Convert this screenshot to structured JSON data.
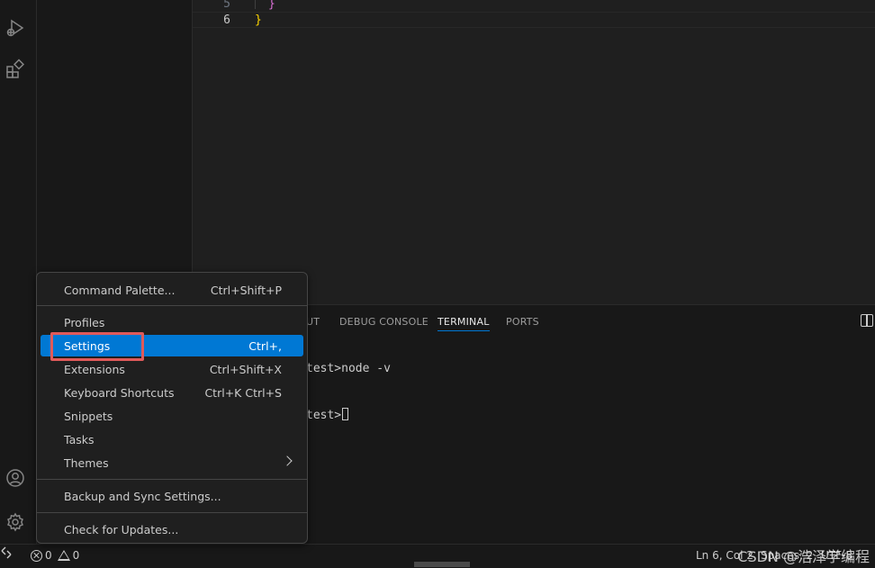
{
  "editor": {
    "lines": [
      {
        "number": "5",
        "text": "}"
      },
      {
        "number": "6",
        "text": "}"
      }
    ]
  },
  "panel": {
    "tabs": [
      {
        "label": "UT"
      },
      {
        "label": "DEBUG CONSOLE"
      },
      {
        "label": "TERMINAL"
      },
      {
        "label": "PORTS"
      }
    ],
    "active_tab": "TERMINAL",
    "terminal_lines": [
      "test>node -v",
      "test>"
    ]
  },
  "menu": {
    "items": [
      {
        "label": "Command Palette...",
        "shortcut": "Ctrl+Shift+P"
      },
      {
        "label": "Profiles",
        "shortcut": ""
      },
      {
        "label": "Settings",
        "shortcut": "Ctrl+,"
      },
      {
        "label": "Extensions",
        "shortcut": "Ctrl+Shift+X"
      },
      {
        "label": "Keyboard Shortcuts",
        "shortcut": "Ctrl+K Ctrl+S"
      },
      {
        "label": "Snippets",
        "shortcut": ""
      },
      {
        "label": "Tasks",
        "shortcut": ""
      },
      {
        "label": "Themes",
        "shortcut": ""
      },
      {
        "label": "Backup and Sync Settings...",
        "shortcut": ""
      },
      {
        "label": "Check for Updates...",
        "shortcut": ""
      }
    ],
    "selected": "Settings"
  },
  "status_bar": {
    "errors": "0",
    "warnings": "0",
    "cursor_position": "Ln 6, Col 2",
    "indent": "Spaces: 2",
    "encoding": "UTF-8",
    "watermark": "CSDN @浩泽学编程"
  },
  "colors": {
    "accent": "#0078d4",
    "highlight_box": "#e05a5a",
    "brace_purple": "#da70d6",
    "brace_yellow": "#ffd700"
  },
  "icons": [
    "run-debug-icon",
    "extensions-icon",
    "accounts-icon",
    "manage-gear-icon",
    "remote-icon",
    "error-icon",
    "warning-icon",
    "split-panel-icon",
    "chevron-right-icon"
  ]
}
